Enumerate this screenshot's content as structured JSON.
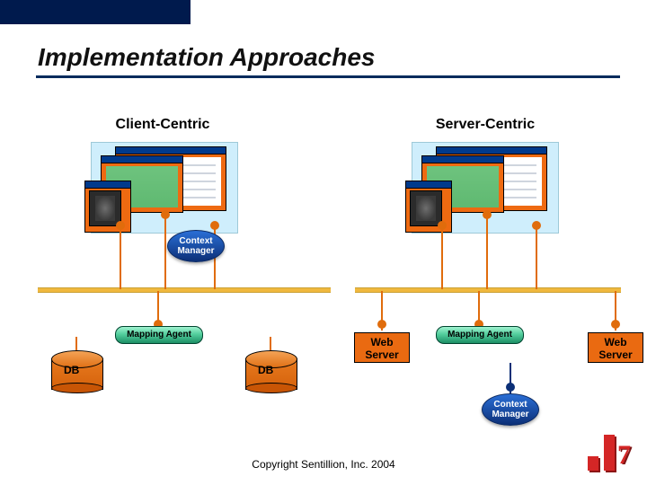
{
  "title": "Implementation Approaches",
  "headers": {
    "client": "Client-Centric",
    "server": "Server-Centric"
  },
  "ctx": {
    "line1": "Context",
    "line2": "Manager"
  },
  "mapping_agent": "Mapping Agent",
  "web_server": {
    "line1": "Web",
    "line2": "Server"
  },
  "db": "DB",
  "copyright": "Copyright Sentillion, Inc. 2004"
}
